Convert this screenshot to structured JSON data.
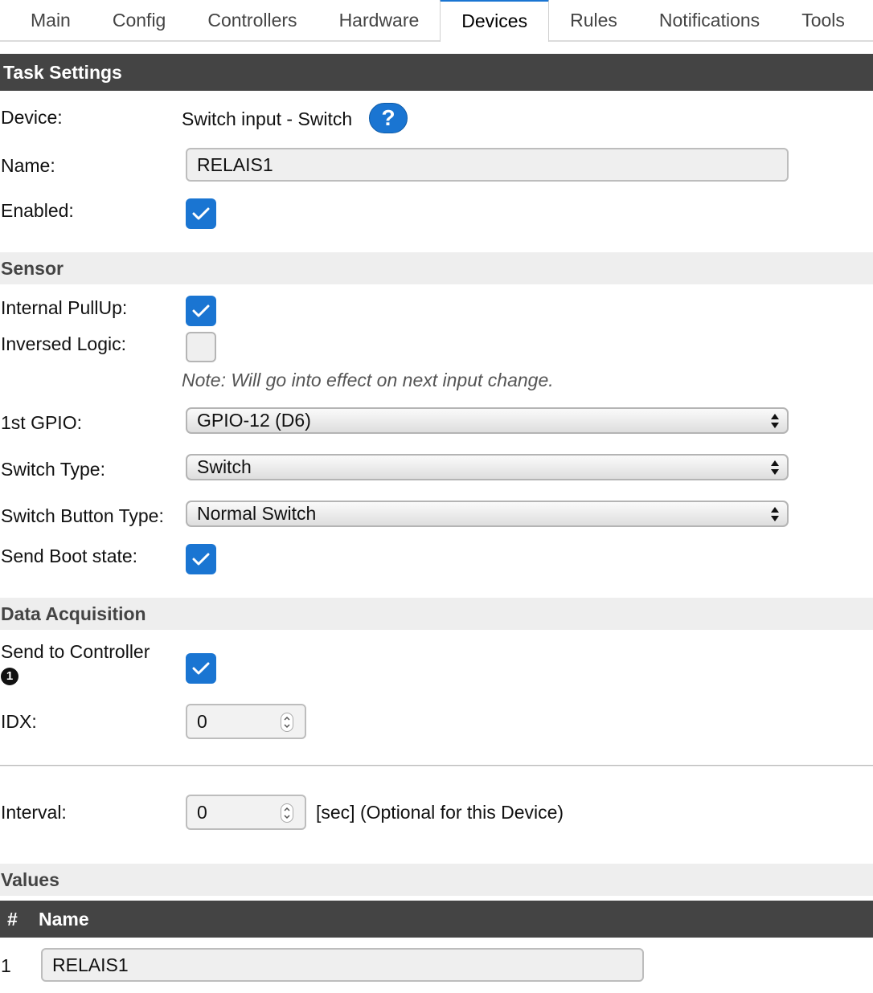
{
  "tabs": [
    {
      "label": "Main"
    },
    {
      "label": "Config"
    },
    {
      "label": "Controllers"
    },
    {
      "label": "Hardware"
    },
    {
      "label": "Devices"
    },
    {
      "label": "Rules"
    },
    {
      "label": "Notifications"
    },
    {
      "label": "Tools"
    }
  ],
  "active_tab": "Devices",
  "task_settings": {
    "header": "Task Settings",
    "device_label": "Device:",
    "device_value": "Switch input - Switch",
    "help_glyph": "?",
    "name_label": "Name:",
    "name_value": "RELAIS1",
    "enabled_label": "Enabled:",
    "enabled": true
  },
  "sensor": {
    "header": "Sensor",
    "pullup_label": "Internal PullUp:",
    "pullup": true,
    "inversed_label": "Inversed Logic:",
    "inversed": false,
    "note": "Note: Will go into effect on next input change.",
    "gpio_label": "1st GPIO:",
    "gpio_value": "GPIO-12 (D6)",
    "switch_type_label": "Switch Type:",
    "switch_type_value": "Switch",
    "button_type_label": "Switch Button Type:",
    "button_type_value": "Normal Switch",
    "boot_state_label": "Send Boot state:",
    "boot_state": true
  },
  "data_acquisition": {
    "header": "Data Acquisition",
    "send_label": "Send to Controller",
    "controller_number": "1",
    "send": true,
    "idx_label": "IDX:",
    "idx_value": "0",
    "interval_label": "Interval:",
    "interval_value": "0",
    "interval_suffix": "[sec] (Optional for this Device)"
  },
  "values": {
    "header": "Values",
    "col_num": "#",
    "col_name": "Name",
    "rows": [
      {
        "num": "1",
        "name": "RELAIS1"
      }
    ]
  },
  "colors": {
    "accent": "#1a75d2",
    "header_bg": "#444444",
    "section_bg": "#eeeeee"
  }
}
